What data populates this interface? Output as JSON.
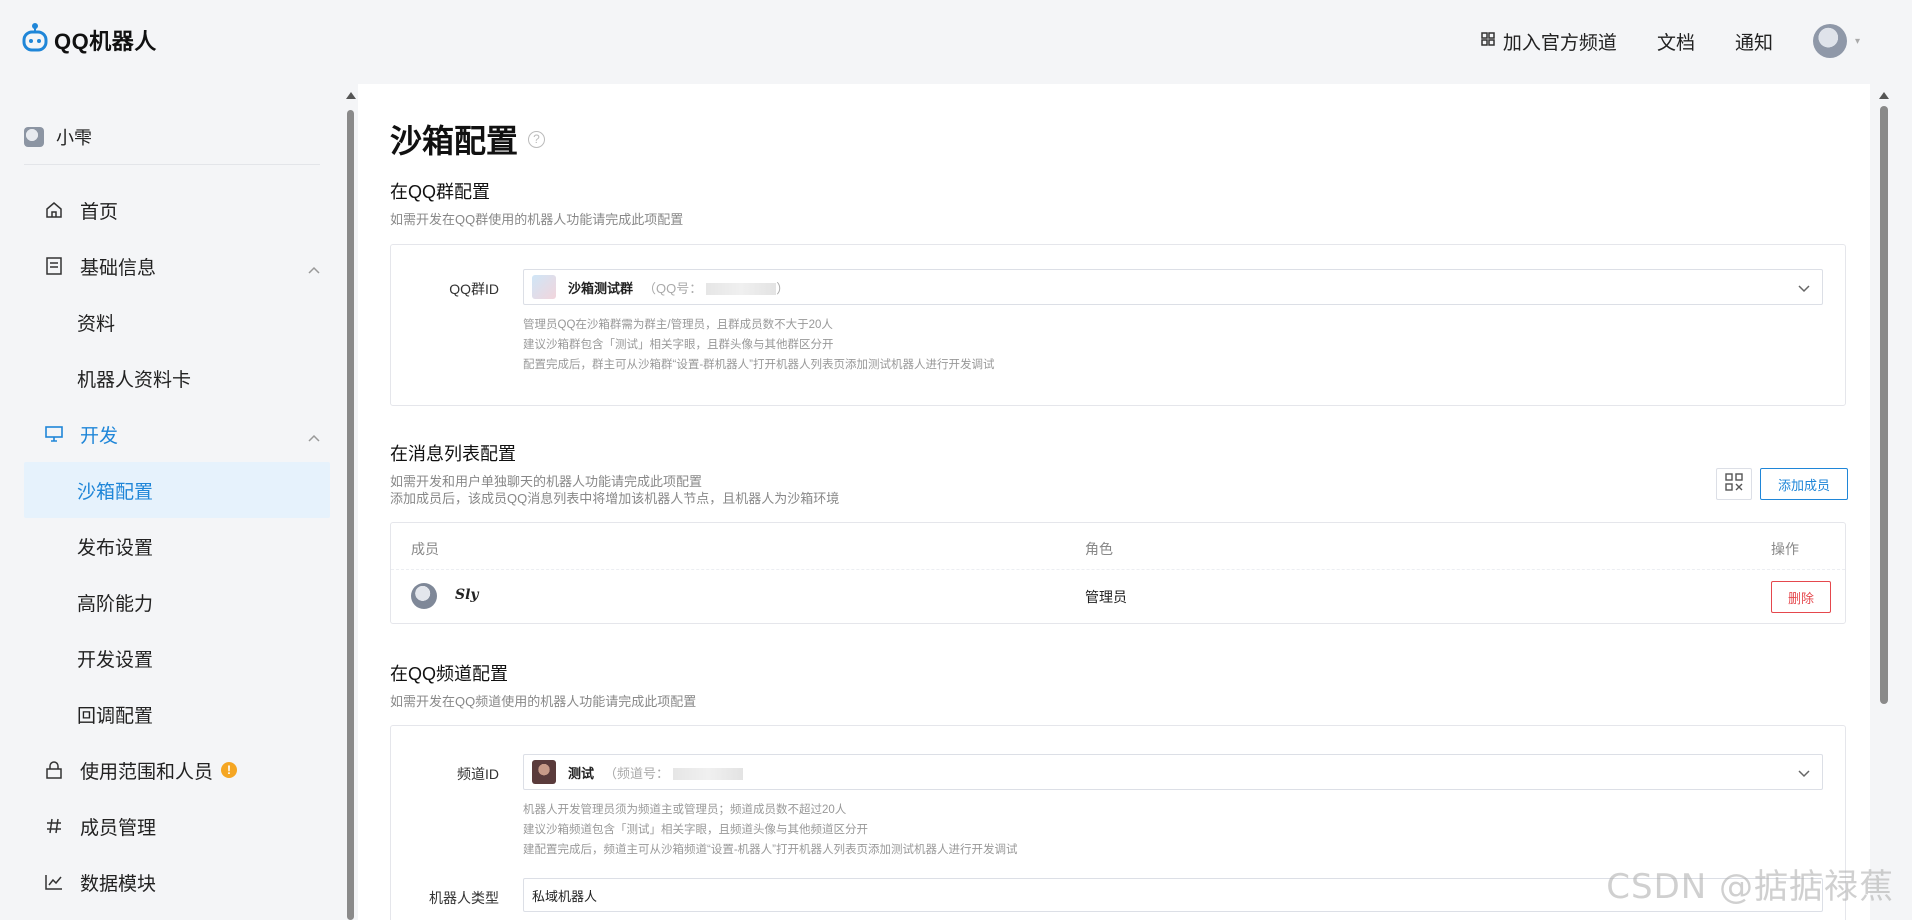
{
  "app": {
    "name": "QQ机器人"
  },
  "header": {
    "join_channel": "加入官方频道",
    "docs": "文档",
    "notifications": "通知"
  },
  "sidebar": {
    "user_name": "小雫",
    "items": [
      {
        "label": "首页"
      },
      {
        "label": "基础信息"
      },
      {
        "label": "资料"
      },
      {
        "label": "机器人资料卡"
      },
      {
        "label": "开发"
      },
      {
        "label": "沙箱配置"
      },
      {
        "label": "发布设置"
      },
      {
        "label": "高阶能力"
      },
      {
        "label": "开发设置"
      },
      {
        "label": "回调配置"
      },
      {
        "label": "使用范围和人员",
        "badge": "!"
      },
      {
        "label": "成员管理"
      },
      {
        "label": "数据模块"
      }
    ]
  },
  "page": {
    "title": "沙箱配置",
    "group": {
      "title": "在QQ群配置",
      "desc": "如需开发在QQ群使用的机器人功能请完成此项配置",
      "field_label": "QQ群ID",
      "selected_name": "沙箱测试群",
      "selected_meta": "（QQ号：",
      "selected_meta_end": "）",
      "hints": [
        "管理员QQ在沙箱群需为群主/管理员，且群成员数不大于20人",
        "建议沙箱群包含「测试」相关字眼，且群头像与其他群区分开",
        "配置完成后，群主可从沙箱群“设置-群机器人”打开机器人列表页添加测试机器人进行开发调试"
      ]
    },
    "msglist": {
      "title": "在消息列表配置",
      "desc1": "如需开发和用户单独聊天的机器人功能请完成此项配置",
      "desc2": "添加成员后，该成员QQ消息列表中将增加该机器人节点，且机器人为沙箱环境",
      "add_button": "添加成员",
      "columns": [
        "成员",
        "角色",
        "操作"
      ],
      "rows": [
        {
          "member": "𝑺𝒍𝒚",
          "role": "管理员",
          "action": "删除"
        }
      ]
    },
    "channel": {
      "title": "在QQ频道配置",
      "desc": "如需开发在QQ频道使用的机器人功能请完成此项配置",
      "field_label": "频道ID",
      "selected_name": "测试",
      "selected_meta": "（频道号：",
      "hints": [
        "机器人开发管理员须为频道主或管理员；频道成员数不超过20人",
        "建议沙箱频道包含「测试」相关字眼，且频道头像与其他频道区分开",
        "建配置完成后，频道主可从沙箱频道“设置-机器人”打开机器人列表页添加测试机器人进行开发调试"
      ],
      "type_label": "机器人类型",
      "type_value": "私域机器人"
    }
  },
  "watermark": "CSDN @掂掂禄蕉",
  "colors": {
    "accent": "#1f86d8",
    "danger": "#e5484d",
    "badge": "#f5a623"
  }
}
